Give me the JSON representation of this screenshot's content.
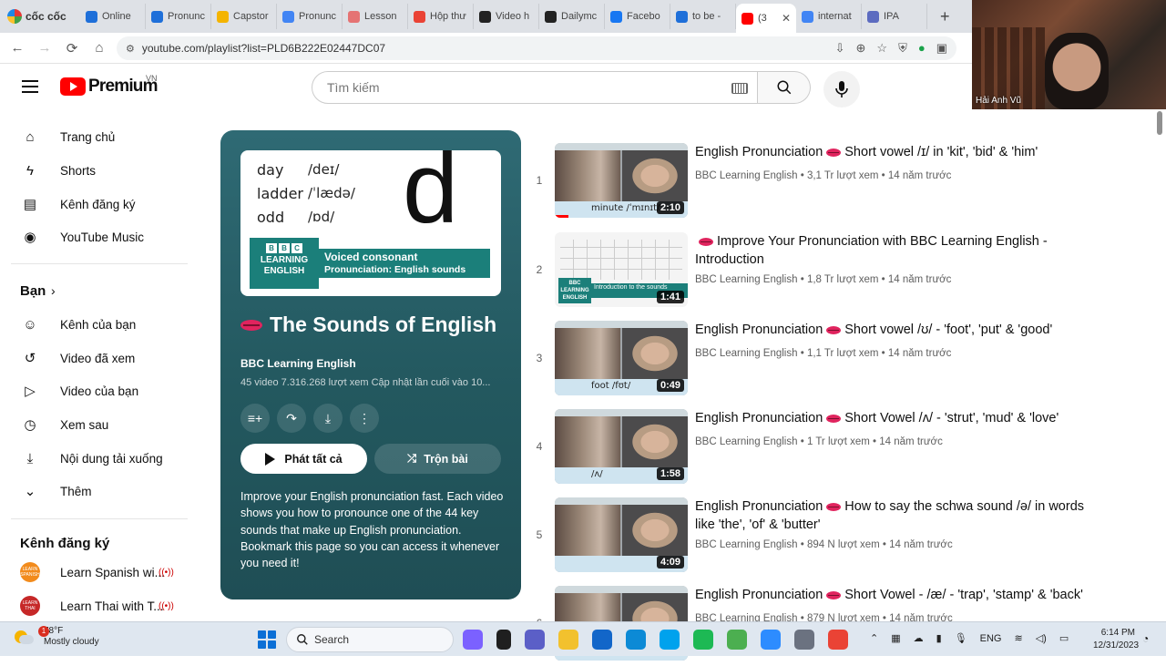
{
  "browser": {
    "name": "cốc cốc",
    "tabs": [
      {
        "label": "Online",
        "color": "#1e6fd9"
      },
      {
        "label": "Pronunc",
        "color": "#1e6fd9"
      },
      {
        "label": "Capstor",
        "color": "#f4b400"
      },
      {
        "label": "Pronunc",
        "color": "#4285f4"
      },
      {
        "label": "Lesson",
        "color": "#e57373"
      },
      {
        "label": "Hộp thư",
        "color": "#ea4335"
      },
      {
        "label": "Video h",
        "color": "#222222"
      },
      {
        "label": "Dailymc",
        "color": "#222222"
      },
      {
        "label": "Facebo",
        "color": "#1877f2"
      },
      {
        "label": "to be -",
        "color": "#1e6fd9"
      },
      {
        "label": "(3",
        "color": "#ff0000"
      },
      {
        "label": "internat",
        "color": "#4285f4"
      },
      {
        "label": "IPA",
        "color": "#5c6bc0"
      }
    ],
    "url": "youtube.com/playlist?list=PLD6B222E02447DC07"
  },
  "webcam": {
    "name": "Hải Anh Vũ"
  },
  "header": {
    "logo_text": "Premium",
    "region": "VN",
    "search_placeholder": "Tìm kiếm"
  },
  "sidebar": {
    "main": [
      {
        "label": "Trang chủ",
        "icon": "home-icon"
      },
      {
        "label": "Shorts",
        "icon": "shorts-icon"
      },
      {
        "label": "Kênh đăng ký",
        "icon": "subscriptions-icon"
      },
      {
        "label": "YouTube Music",
        "icon": "music-icon"
      }
    ],
    "you_heading": "Bạn",
    "you": [
      {
        "label": "Kênh của bạn",
        "icon": "your-channel-icon"
      },
      {
        "label": "Video đã xem",
        "icon": "history-icon"
      },
      {
        "label": "Video của bạn",
        "icon": "your-videos-icon"
      },
      {
        "label": "Xem sau",
        "icon": "watch-later-icon"
      },
      {
        "label": "Nội dung tải xuống",
        "icon": "downloads-icon"
      },
      {
        "label": "Thêm",
        "icon": "chevron-down-icon"
      }
    ],
    "subs_heading": "Kênh đăng ký",
    "subs": [
      {
        "label": "Learn Spanish wi...",
        "avatar": "LEARN SPANISH",
        "color": "#f28b1c"
      },
      {
        "label": "Learn Thai with T...",
        "avatar": "LEARN THAI",
        "color": "#c62828"
      }
    ]
  },
  "playlist": {
    "thumb": {
      "words": [
        "day",
        "ladder",
        "odd"
      ],
      "ipa": [
        "/deɪ/",
        "/ˈlædə/",
        "/ɒd/"
      ],
      "big_letter": "d",
      "bbc": [
        "B",
        "B",
        "C"
      ],
      "logo_line1": "LEARNING",
      "logo_line2": "ENGLISH",
      "banner_line1": "Voiced consonant",
      "banner_line2": "Pronunciation: English sounds"
    },
    "title": "The Sounds of English",
    "owner": "BBC Learning English",
    "meta": "45 video  7.316.268 lượt xem  Cập nhật lần cuối vào 10...",
    "play_all": "Phát tất cả",
    "shuffle": "Trộn bài",
    "description": "Improve your English pronunciation fast. Each video shows you how to pronounce one of the 44 key sounds that make up English pronunciation. Bookmark this page so you can access it whenever you need it!"
  },
  "videos": [
    {
      "index": "1",
      "title_a": "English Pronunciation",
      "title_b": "Short vowel /ɪ/ in 'kit', 'bid' & 'him'",
      "lips_first": false,
      "channel": "BBC Learning English",
      "stats": "3,1 Tr lượt xem • 14 năm trước",
      "duration": "2:10",
      "caption": "minute /ˈmɪnɪt/",
      "style": "faces",
      "watched": 0.1
    },
    {
      "index": "2",
      "title_a": "",
      "title_b": "Improve Your Pronunciation with BBC Learning English - Introduction",
      "lips_first": true,
      "channel": "BBC Learning English",
      "stats": "1,8 Tr lượt xem • 14 năm trước",
      "duration": "1:41",
      "caption": "Introduction to the sounds",
      "style": "chart",
      "watched": 0
    },
    {
      "index": "3",
      "title_a": "English Pronunciation",
      "title_b": "Short vowel /ʊ/ - 'foot', 'put' & 'good'",
      "lips_first": false,
      "channel": "BBC Learning English",
      "stats": "1,1 Tr lượt xem • 14 năm trước",
      "duration": "0:49",
      "caption": "foot /fʊt/",
      "style": "faces",
      "watched": 0
    },
    {
      "index": "4",
      "title_a": "English Pronunciation",
      "title_b": "Short Vowel /ʌ/ - 'strut', 'mud' & 'love'",
      "lips_first": false,
      "channel": "BBC Learning English",
      "stats": "1 Tr lượt xem • 14 năm trước",
      "duration": "1:58",
      "caption": "/ʌ/",
      "style": "faces",
      "watched": 0
    },
    {
      "index": "5",
      "title_a": "English Pronunciation",
      "title_b": "How to say the schwa sound /ə/ in words like 'the', 'of' & 'butter'",
      "lips_first": false,
      "channel": "BBC Learning English",
      "stats": "894 N lượt xem • 14 năm trước",
      "duration": "4:09",
      "caption": "",
      "style": "faces",
      "watched": 0
    },
    {
      "index": "6",
      "title_a": "English Pronunciation",
      "title_b": "Short Vowel - /æ/ - 'trap', 'stamp' & 'back'",
      "lips_first": false,
      "channel": "BBC Learning English",
      "stats": "879 N lượt xem • 14 năm trước",
      "duration": "",
      "caption": "",
      "style": "faces",
      "watched": 0
    }
  ],
  "taskbar": {
    "temp": "78°F",
    "condition": "Mostly cloudy",
    "weather_badge": "1",
    "search": "Search",
    "lang": "ENG",
    "time": "6:14 PM",
    "date": "12/31/2023",
    "apps": [
      {
        "name": "widgets-icon",
        "color": "#7b61ff"
      },
      {
        "name": "task-view-icon",
        "color": "#1f1f1f"
      },
      {
        "name": "chat-icon",
        "color": "#5b5fc7"
      },
      {
        "name": "file-explorer-icon",
        "color": "#f2c12e"
      },
      {
        "name": "store-icon",
        "color": "#1266c9"
      },
      {
        "name": "edge-icon",
        "color": "#0c8ad6"
      },
      {
        "name": "skype-icon",
        "color": "#00a2ed"
      },
      {
        "name": "spotify-icon",
        "color": "#1db954"
      },
      {
        "name": "coccoc-icon",
        "color": "#4caf50"
      },
      {
        "name": "zoom-icon",
        "color": "#2d8cff"
      },
      {
        "name": "camera-icon",
        "color": "#6b7280"
      },
      {
        "name": "chrome-icon",
        "color": "#ea4335"
      }
    ]
  }
}
